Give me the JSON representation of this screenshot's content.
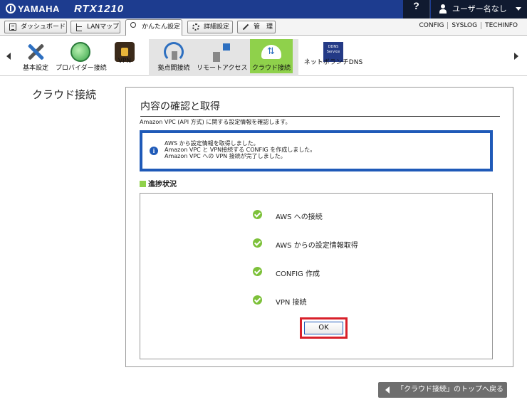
{
  "header": {
    "brand": "YAMAHA",
    "model": "RTX1210",
    "help_label": "?",
    "user_label": "ユーザー名なし"
  },
  "tabs": [
    {
      "label": "ダッシュボード"
    },
    {
      "label": "LANマップ"
    },
    {
      "label": "かんたん設定"
    },
    {
      "label": "詳細設定"
    },
    {
      "label": "管　理"
    }
  ],
  "links": [
    "CONFIG",
    "SYSLOG",
    "TECHINFO"
  ],
  "menu": {
    "items": [
      {
        "label": "基本設定"
      },
      {
        "label": "プロバイダー接続"
      },
      {
        "label": "VPN"
      },
      {
        "label": "拠点間接続"
      },
      {
        "label": "リモートアクセス"
      },
      {
        "label": "クラウド接続"
      },
      {
        "label": "ネットボランチDNS"
      }
    ],
    "dns_icon_text": "DDNS Service",
    "selected": "クラウド接続"
  },
  "page": {
    "section_title": "クラウド接続",
    "title": "内容の確認と取得",
    "description": "Amazon VPC (API 方式) に関する設定情報を確認します。",
    "info_lines": [
      "AWS から設定情報を取得しました。",
      "Amazon VPC と VPN接続する CONFIG を作成しました。",
      "Amazon VPC への VPN 接続が完了しました。"
    ],
    "progress_title": "進捗状況",
    "steps": [
      {
        "label": "AWS への接続"
      },
      {
        "label": "AWS からの設定情報取得"
      },
      {
        "label": "CONFIG 作成"
      },
      {
        "label": "VPN 接続"
      }
    ],
    "ok_label": "OK",
    "back_label": "「クラウド接続」のトップへ戻る"
  },
  "colors": {
    "header_bg": "#1d3c8f",
    "accent_green": "#8fd14b",
    "info_border": "#1f5ab8",
    "highlight_red": "#d8202a"
  }
}
